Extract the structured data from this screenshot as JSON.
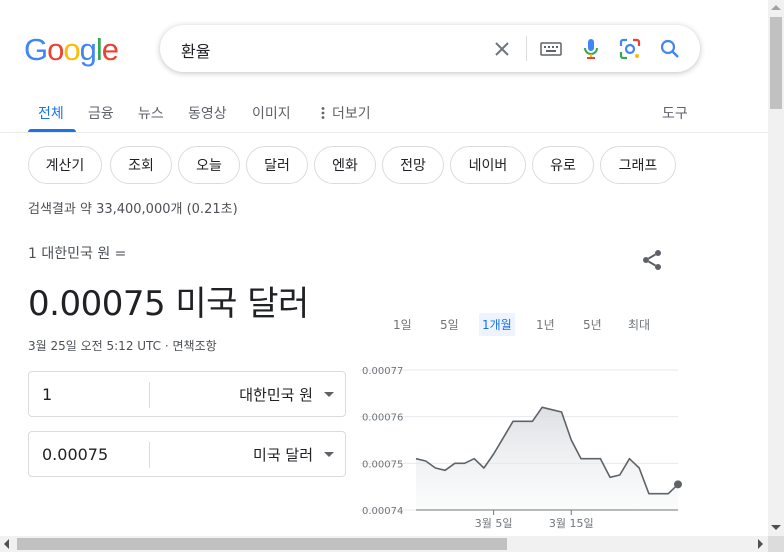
{
  "logo": {
    "letters": [
      "G",
      "o",
      "o",
      "g",
      "l",
      "e"
    ],
    "colors": [
      "#4285f4",
      "#ea4335",
      "#fbbc05",
      "#4285f4",
      "#34a853",
      "#ea4335"
    ]
  },
  "search": {
    "query": "환율",
    "icons": [
      "clear-icon",
      "keyboard-icon",
      "microphone-icon",
      "lens-icon",
      "search-icon"
    ]
  },
  "tabs": [
    {
      "label": "전체",
      "active": true
    },
    {
      "label": "금융"
    },
    {
      "label": "뉴스"
    },
    {
      "label": "동영상"
    },
    {
      "label": "이미지"
    },
    {
      "label": "더보기"
    }
  ],
  "tools_label": "도구",
  "chips": [
    "계산기",
    "조회",
    "오늘",
    "달러",
    "엔화",
    "전망",
    "네이버",
    "유로",
    "그래프"
  ],
  "result_stats": "검색결과 약 33,400,000개 (0.21초)",
  "converter": {
    "from_line": "1 대한민국 원 =",
    "result": "0.00075 미국 달러",
    "timestamp": "3월 25일 오전 5:12 UTC · 면책조항",
    "from_amount": "1",
    "from_currency": "대한민국 원",
    "to_amount": "0.00075",
    "to_currency": "미국 달러"
  },
  "ranges": [
    {
      "label": "1일"
    },
    {
      "label": "5일"
    },
    {
      "label": "1개월",
      "active": true
    },
    {
      "label": "1년"
    },
    {
      "label": "5년"
    },
    {
      "label": "최대"
    }
  ],
  "colors": {
    "accent": "#1a73e8",
    "line": "#5f6368",
    "area": "#e8eaed"
  },
  "chart_data": {
    "type": "area",
    "yticks": [
      "0.00077",
      "0.00076",
      "0.00075",
      "0.00074"
    ],
    "ylim": [
      0.00074,
      0.00077
    ],
    "xticks": [
      {
        "label": "3월 5일",
        "index": 8
      },
      {
        "label": "3월 15일",
        "index": 16
      }
    ],
    "values": [
      0.000751,
      0.0007505,
      0.000749,
      0.0007485,
      0.00075,
      0.00075,
      0.000751,
      0.000749,
      0.000752,
      0.0007555,
      0.000759,
      0.000759,
      0.000759,
      0.000762,
      0.0007615,
      0.000761,
      0.000755,
      0.000751,
      0.000751,
      0.000751,
      0.000747,
      0.0007475,
      0.000751,
      0.000749,
      0.0007435,
      0.0007435,
      0.0007435,
      0.0007455
    ]
  }
}
